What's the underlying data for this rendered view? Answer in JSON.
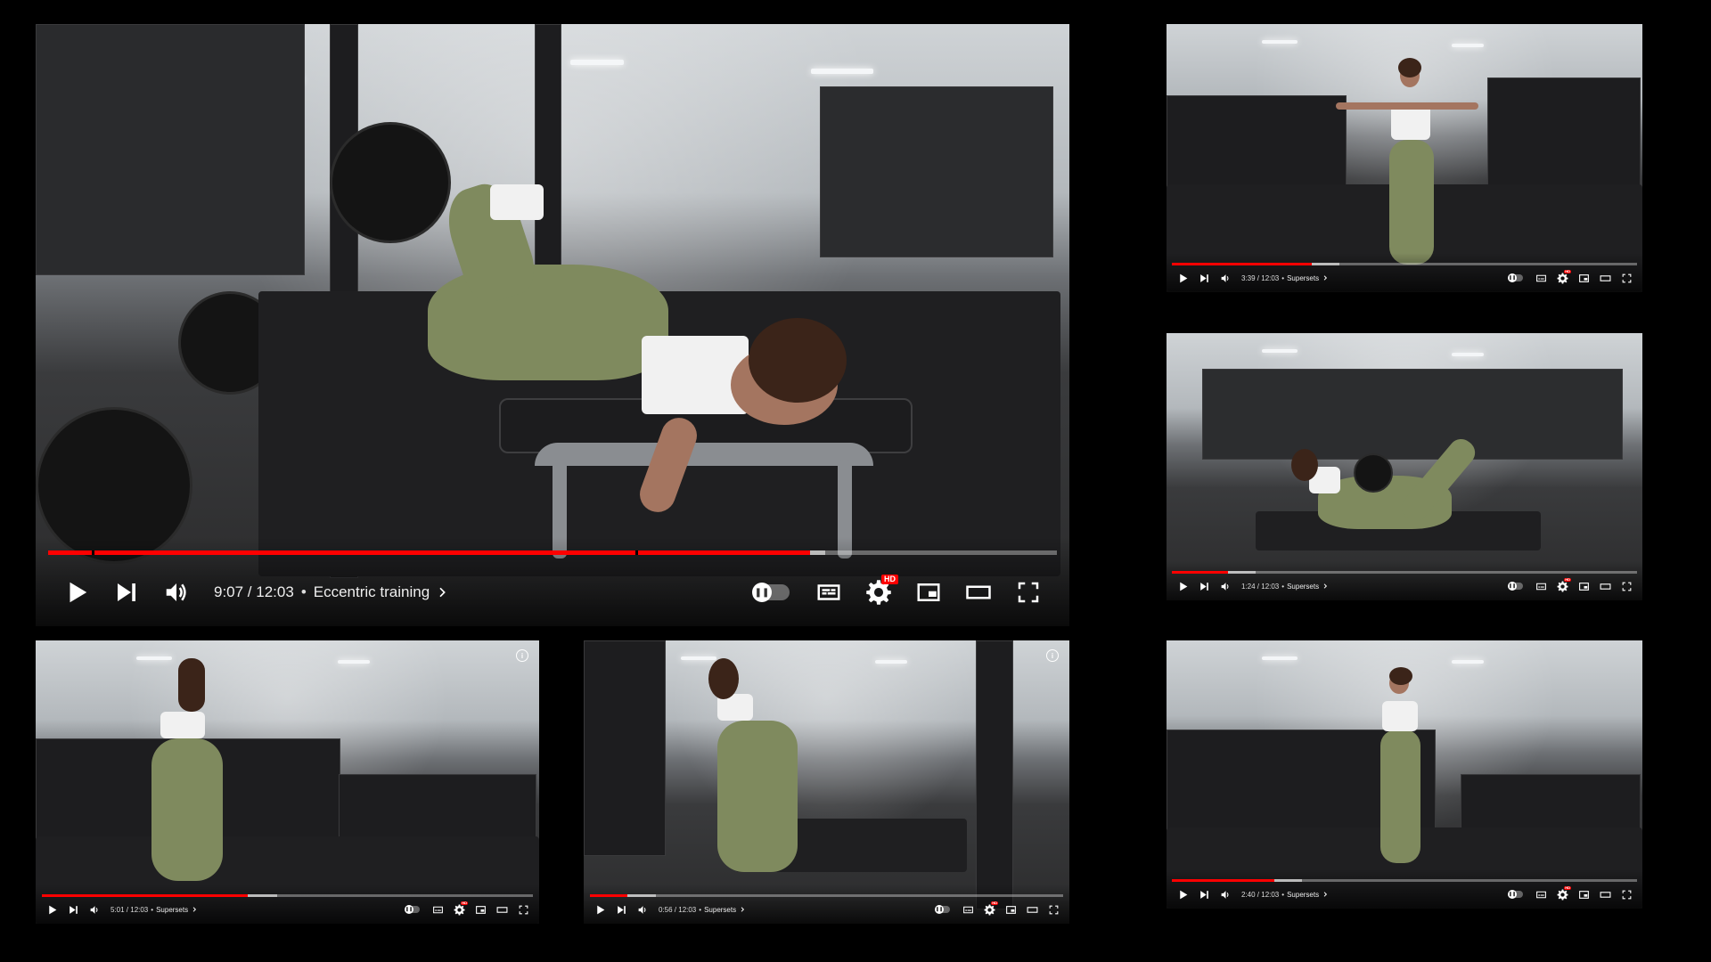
{
  "main_player": {
    "current_time": "9:07",
    "duration": "12:03",
    "time_label": "9:07 / 12:03",
    "separator": "•",
    "chapter": "Eccentric training",
    "progress_fraction": 0.755,
    "buffered_fraction": 0.77,
    "hd_badge": "HD"
  },
  "small_players": [
    {
      "id": "top-right",
      "time_label": "3:39 / 12:03",
      "separator": "•",
      "chapter": "Supersets",
      "progress_fraction": 0.3,
      "hd_badge": "HD"
    },
    {
      "id": "middle-right",
      "time_label": "1:24 / 12:03",
      "separator": "•",
      "chapter": "Supersets",
      "progress_fraction": 0.12,
      "hd_badge": "HD"
    },
    {
      "id": "bottom-right",
      "time_label": "2:40 / 12:03",
      "separator": "•",
      "chapter": "Supersets",
      "progress_fraction": 0.22,
      "hd_badge": "HD"
    },
    {
      "id": "bottom-left",
      "time_label": "5:01 / 12:03",
      "separator": "•",
      "chapter": "Supersets",
      "progress_fraction": 0.42,
      "hd_badge": "HD",
      "info": "i"
    },
    {
      "id": "bottom-middle",
      "time_label": "0:56 / 12:03",
      "separator": "•",
      "chapter": "Supersets",
      "progress_fraction": 0.08,
      "hd_badge": "HD",
      "info": "i"
    }
  ],
  "icons": {
    "play": "play-icon",
    "next": "next-icon",
    "volume": "volume-icon",
    "chevron": "chevron-right-icon",
    "autoplay": "autoplay-toggle",
    "subtitles": "subtitles-icon",
    "settings": "gear-icon",
    "miniplayer": "miniplayer-icon",
    "theater": "theater-mode-icon",
    "fullscreen": "fullscreen-icon",
    "info": "info-icon"
  },
  "colors": {
    "progress_played": "#ff0000",
    "background": "#000000",
    "leggings": "#7f8a5e"
  }
}
